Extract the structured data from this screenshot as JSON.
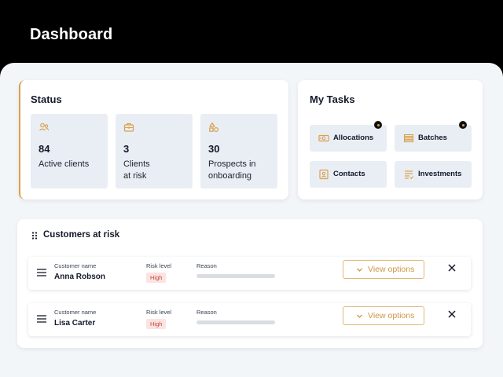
{
  "header": {
    "title": "Dashboard"
  },
  "status": {
    "title": "Status",
    "tiles": [
      {
        "icon": "users-icon",
        "value": "84",
        "label": "Active clients"
      },
      {
        "icon": "briefcase-icon",
        "value": "3",
        "label": "Clients at risk"
      },
      {
        "icon": "shapes-icon",
        "value": "30",
        "label": "Prospects in onboarding"
      }
    ]
  },
  "tasks": {
    "title": "My Tasks",
    "items": [
      {
        "label": "Allocations",
        "icon": "money-icon",
        "has_notification": true
      },
      {
        "label": "Batches",
        "icon": "stack-icon",
        "has_notification": true
      },
      {
        "label": "Contacts",
        "icon": "contact-card-icon",
        "has_notification": false
      },
      {
        "label": "Investments",
        "icon": "document-icon",
        "has_notification": false
      }
    ]
  },
  "risk": {
    "title": "Customers at risk",
    "col_customer": "Customer name",
    "col_risk": "Risk level",
    "col_reason": "Reason",
    "view_label": "View options",
    "rows": [
      {
        "name": "Anna Robson",
        "level": "High"
      },
      {
        "name": "Lisa Carter",
        "level": "High"
      }
    ]
  },
  "colors": {
    "accent": "#d9a04d",
    "header_bg": "#000000",
    "tile_bg": "#e9eef4",
    "badge_bg": "#fbe3e1",
    "badge_text": "#c54a3f"
  }
}
